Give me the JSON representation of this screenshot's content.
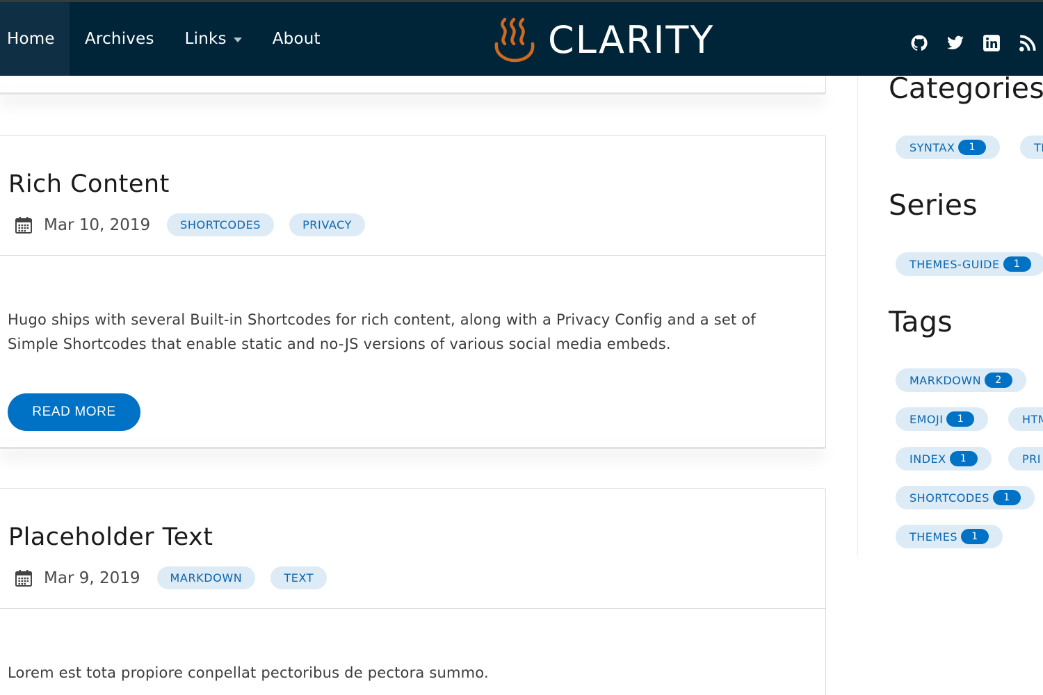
{
  "header": {
    "nav": [
      {
        "label": "Home"
      },
      {
        "label": "Archives"
      },
      {
        "label": "Links"
      },
      {
        "label": "About"
      }
    ],
    "brand": "CLARITY",
    "social": [
      "github-icon",
      "twitter-icon",
      "linkedin-icon",
      "rss-icon"
    ],
    "colors": {
      "bar": "#002538",
      "logo": "#d2691e"
    }
  },
  "posts": [
    {
      "title": "Rich Content",
      "date": "Mar 10, 2019",
      "tags": [
        "SHORTCODES",
        "PRIVACY"
      ],
      "excerpt_lines": [
        "Hugo ships with several Built-in Shortcodes for rich content, along with a Privacy Config and a set of",
        "Simple Shortcodes that enable static and no-JS versions of various social media embeds."
      ],
      "read_more": "READ MORE"
    },
    {
      "title": "Placeholder Text",
      "date": "Mar 9, 2019",
      "tags": [
        "MARKDOWN",
        "TEXT"
      ],
      "excerpt_lines": [
        "Lorem est tota propiore conpellat pectoribus de pectora summo."
      ]
    }
  ],
  "sidebar": {
    "categories": {
      "heading": "Categories",
      "items": [
        {
          "label": "SYNTAX",
          "count": "1"
        },
        {
          "label": "TI",
          "count": ""
        }
      ]
    },
    "series": {
      "heading": "Series",
      "items": [
        {
          "label": "THEMES-GUIDE",
          "count": "1"
        }
      ]
    },
    "tags": {
      "heading": "Tags",
      "items": [
        {
          "label": "MARKDOWN",
          "count": "2"
        },
        {
          "label": "EMOJI",
          "count": "1"
        },
        {
          "label": "HTM",
          "count": ""
        },
        {
          "label": "INDEX",
          "count": "1"
        },
        {
          "label": "PRI",
          "count": ""
        },
        {
          "label": "SHORTCODES",
          "count": "1"
        },
        {
          "label": "THEMES",
          "count": "1"
        }
      ]
    }
  },
  "accent": "#0072c6"
}
